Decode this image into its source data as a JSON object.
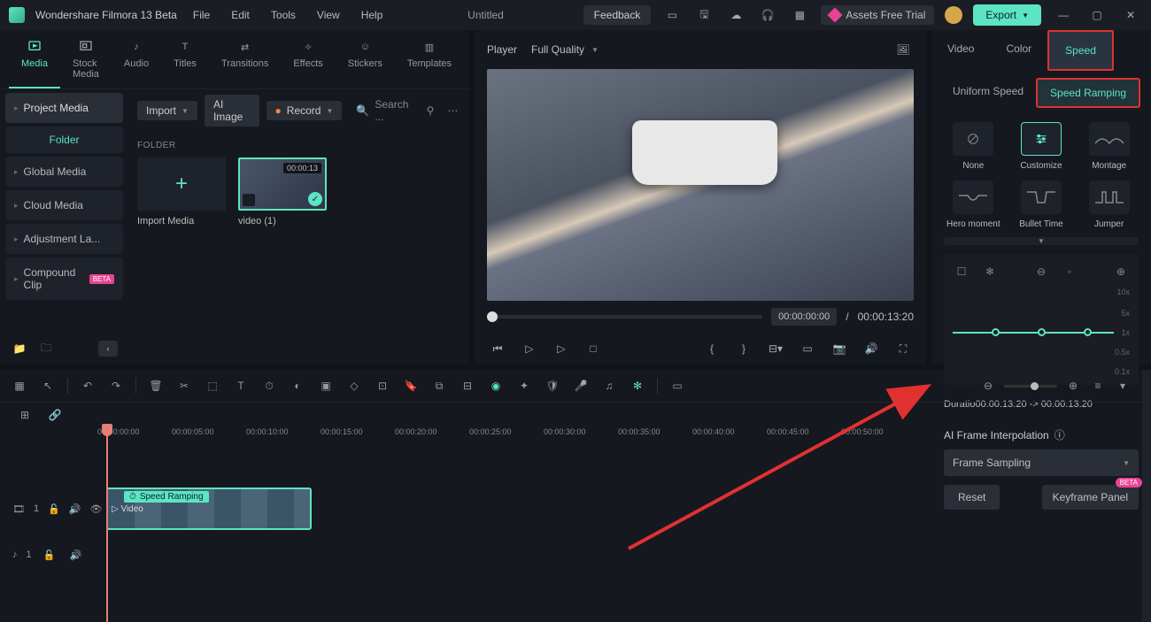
{
  "titlebar": {
    "app_name": "Wondershare Filmora 13 Beta",
    "menus": [
      "File",
      "Edit",
      "Tools",
      "View",
      "Help"
    ],
    "document": "Untitled",
    "feedback": "Feedback",
    "assets_trial": "Assets Free Trial",
    "export": "Export"
  },
  "modules": {
    "tabs": [
      {
        "label": "Media",
        "active": true
      },
      {
        "label": "Stock Media"
      },
      {
        "label": "Audio"
      },
      {
        "label": "Titles"
      },
      {
        "label": "Transitions"
      },
      {
        "label": "Effects"
      },
      {
        "label": "Stickers"
      },
      {
        "label": "Templates"
      }
    ],
    "import_dd": "Import",
    "ai_image": "AI Image",
    "record_dd": "Record",
    "search_ph": "Search ..."
  },
  "sidebar": {
    "header": "Project Media",
    "folder_label": "Folder",
    "items": [
      {
        "label": "Global Media"
      },
      {
        "label": "Cloud Media"
      },
      {
        "label": "Adjustment La..."
      },
      {
        "label": "Compound Clip",
        "badge": "BETA"
      }
    ]
  },
  "library": {
    "folder_head": "FOLDER",
    "import_label": "Import Media",
    "clip_duration": "00:00:13",
    "clip_label": "video (1)"
  },
  "preview": {
    "player": "Player",
    "quality": "Full Quality",
    "time_current": "00:00:00:00",
    "time_sep": "/",
    "time_total": "00:00:13:20"
  },
  "right_panel": {
    "tabs": [
      "Video",
      "Color",
      "Speed"
    ],
    "active_tab": "Speed",
    "subtabs": [
      "Uniform Speed",
      "Speed Ramping"
    ],
    "active_subtab": "Speed Ramping",
    "presets": [
      "None",
      "Customize",
      "Montage",
      "Hero moment",
      "Bullet Time",
      "Jumper"
    ],
    "active_preset": "Customize",
    "speed_labels": [
      "10x",
      "5x",
      "1x",
      "0.5x",
      "0.1x"
    ],
    "duration_text": "Duratio00:00:13:20 -> 00:00:13:20",
    "ai_label": "AI Frame Interpolation",
    "ai_select": "Frame Sampling",
    "reset": "Reset",
    "keyframe": "Keyframe Panel",
    "beta": "BETA"
  },
  "timeline": {
    "marks": [
      "00:00:00:00",
      "00:00:05:00",
      "00:00:10:00",
      "00:00:15:00",
      "00:00:20:00",
      "00:00:25:00",
      "00:00:30:00",
      "00:00:35:00",
      "00:00:40:00",
      "00:00:45:00",
      "00:00:50:00"
    ],
    "clip_badge": "Speed Ramping",
    "clip_name": "Video",
    "video_track": "1",
    "audio_track": "1"
  }
}
